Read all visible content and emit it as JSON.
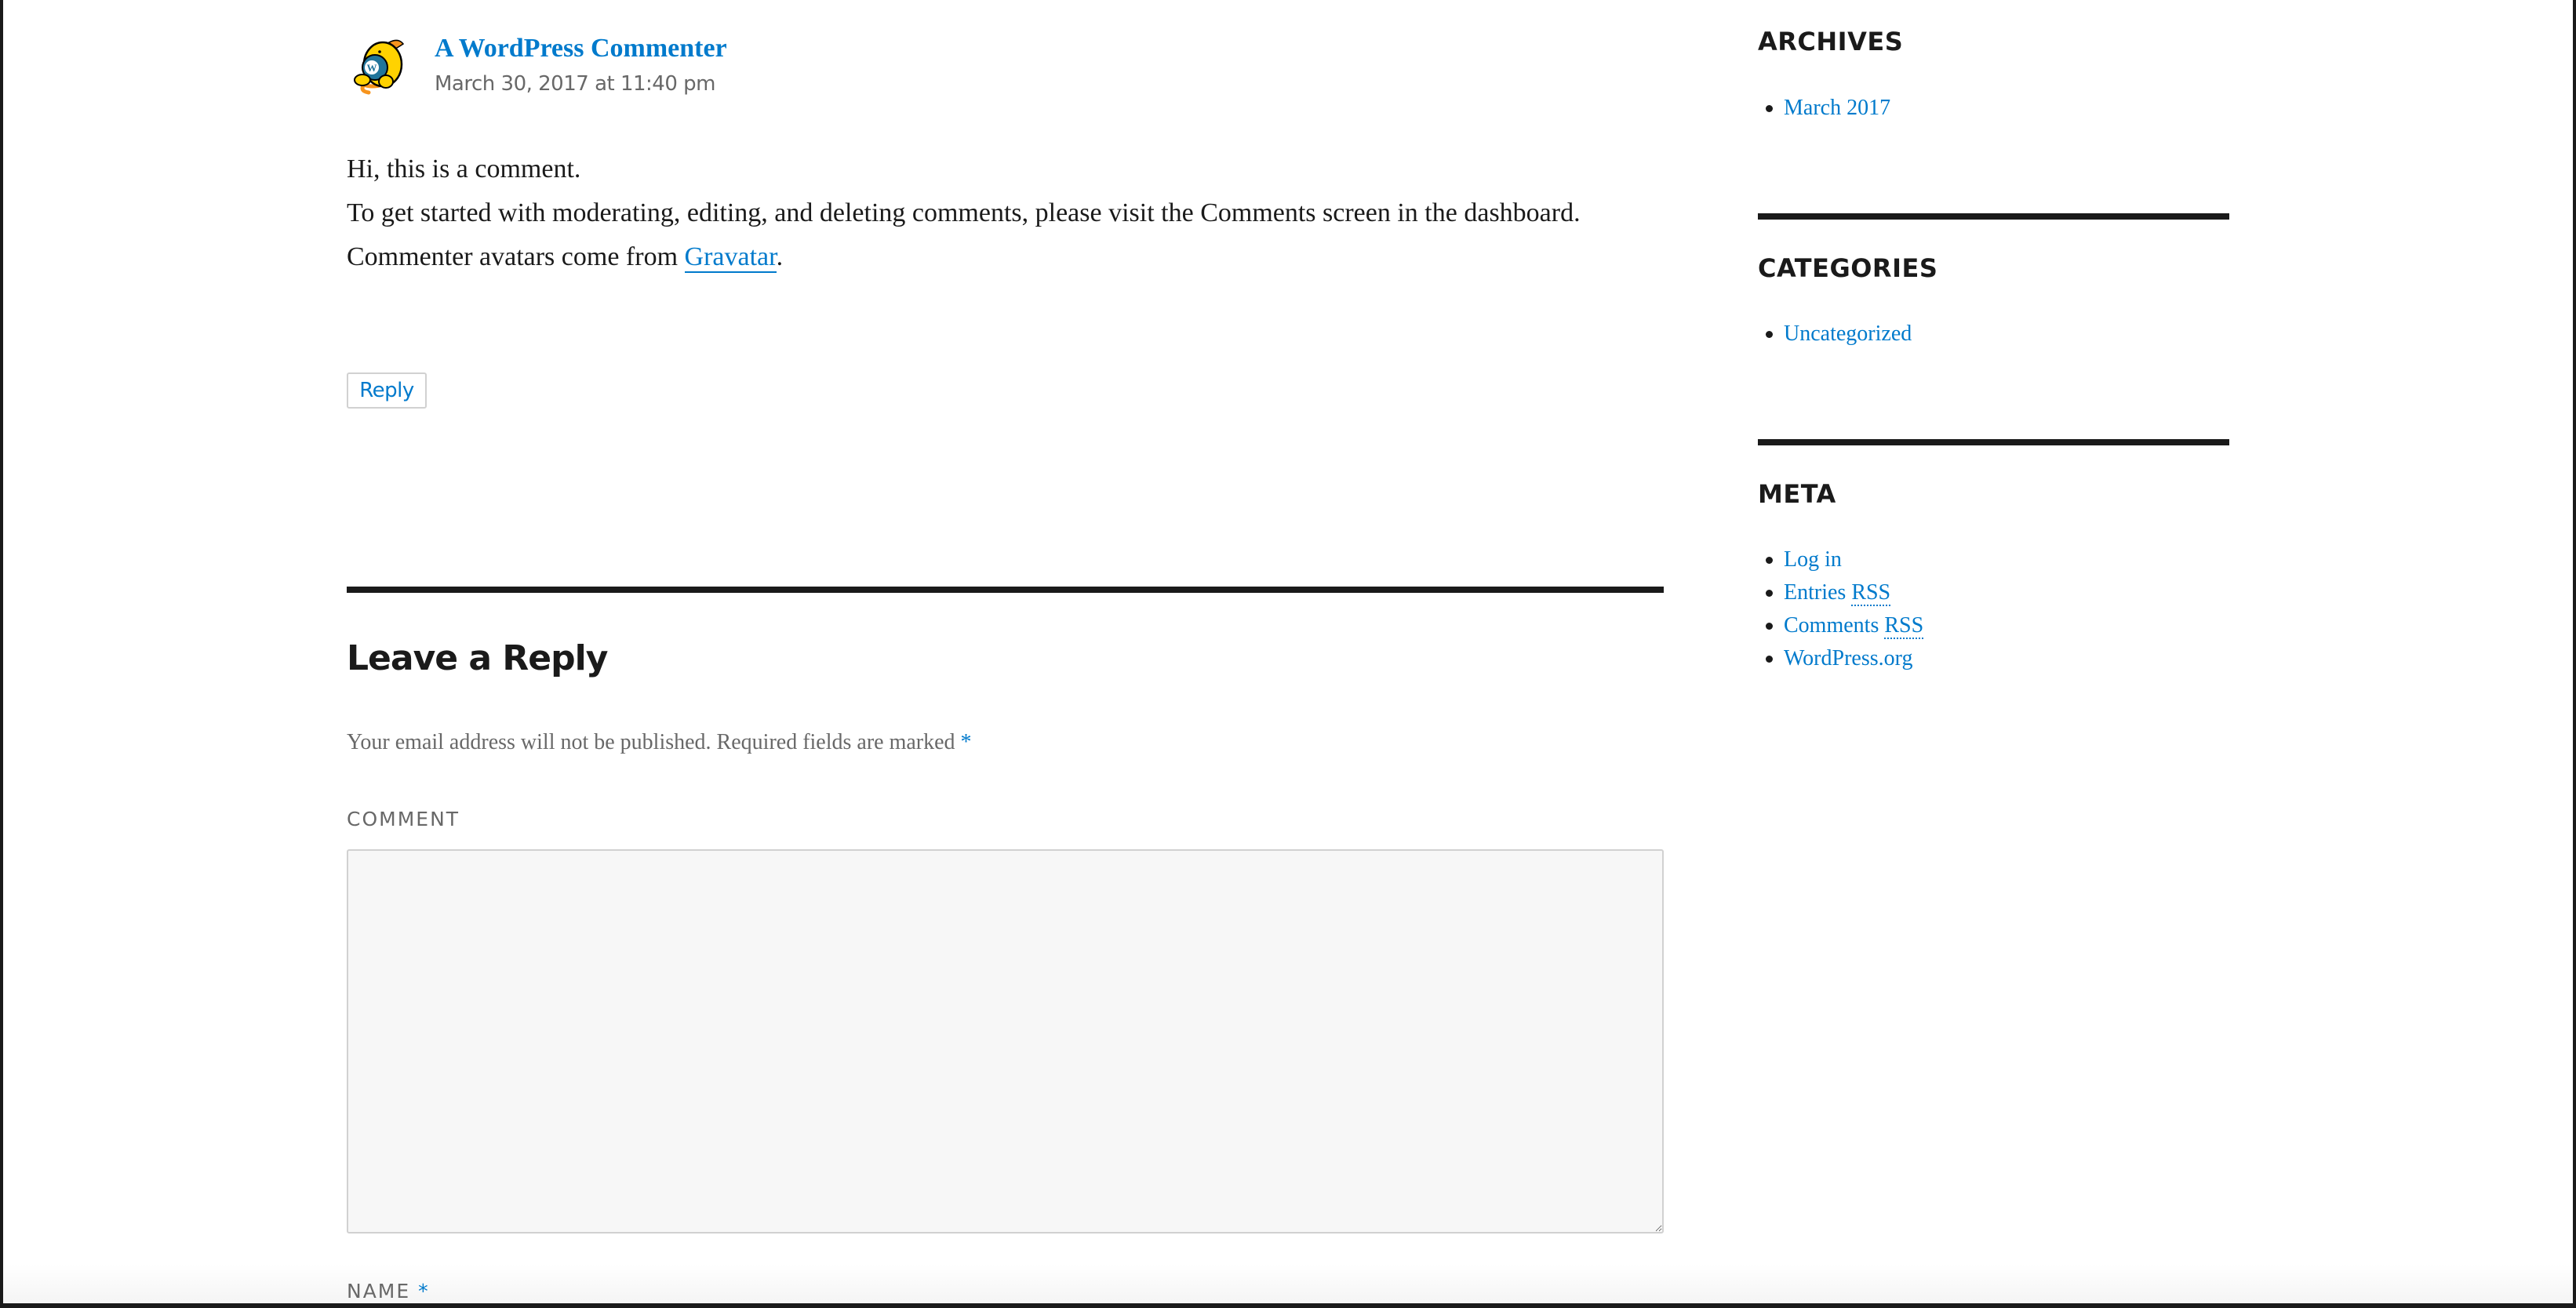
{
  "colors": {
    "accent": "#007acc",
    "text": "#1a1a1a",
    "muted": "#686868",
    "border": "#d1d1d1",
    "input_bg": "#f7f7f7"
  },
  "comment": {
    "author": "A WordPress Commenter",
    "avatar_icon": "wapuu-avatar-icon",
    "date": "March 30, 2017 at 11:40 pm",
    "paragraph_1": "Hi, this is a comment.",
    "paragraph_2": "To get started with moderating, editing, and deleting comments, please visit the Comments screen in the dashboard.",
    "paragraph_3_prefix": "Commenter avatars come from ",
    "paragraph_3_link": "Gravatar",
    "paragraph_3_suffix": ".",
    "reply_label": "Reply"
  },
  "respond": {
    "title": "Leave a Reply",
    "notes": "Your email address will not be published. Required fields are marked ",
    "required_marker": "*",
    "comment_label": "Comment",
    "comment_value": "",
    "name_label": "Name",
    "name_required": "*"
  },
  "sidebar": {
    "archives": {
      "title": "ARCHIVES",
      "items": [
        "March 2017"
      ]
    },
    "categories": {
      "title": "CATEGORIES",
      "items": [
        "Uncategorized"
      ]
    },
    "meta": {
      "title": "META",
      "items": [
        {
          "label": "Log in",
          "abbr": ""
        },
        {
          "label": "Entries ",
          "abbr": "RSS"
        },
        {
          "label": "Comments ",
          "abbr": "RSS"
        },
        {
          "label": "WordPress.org",
          "abbr": ""
        }
      ]
    }
  }
}
